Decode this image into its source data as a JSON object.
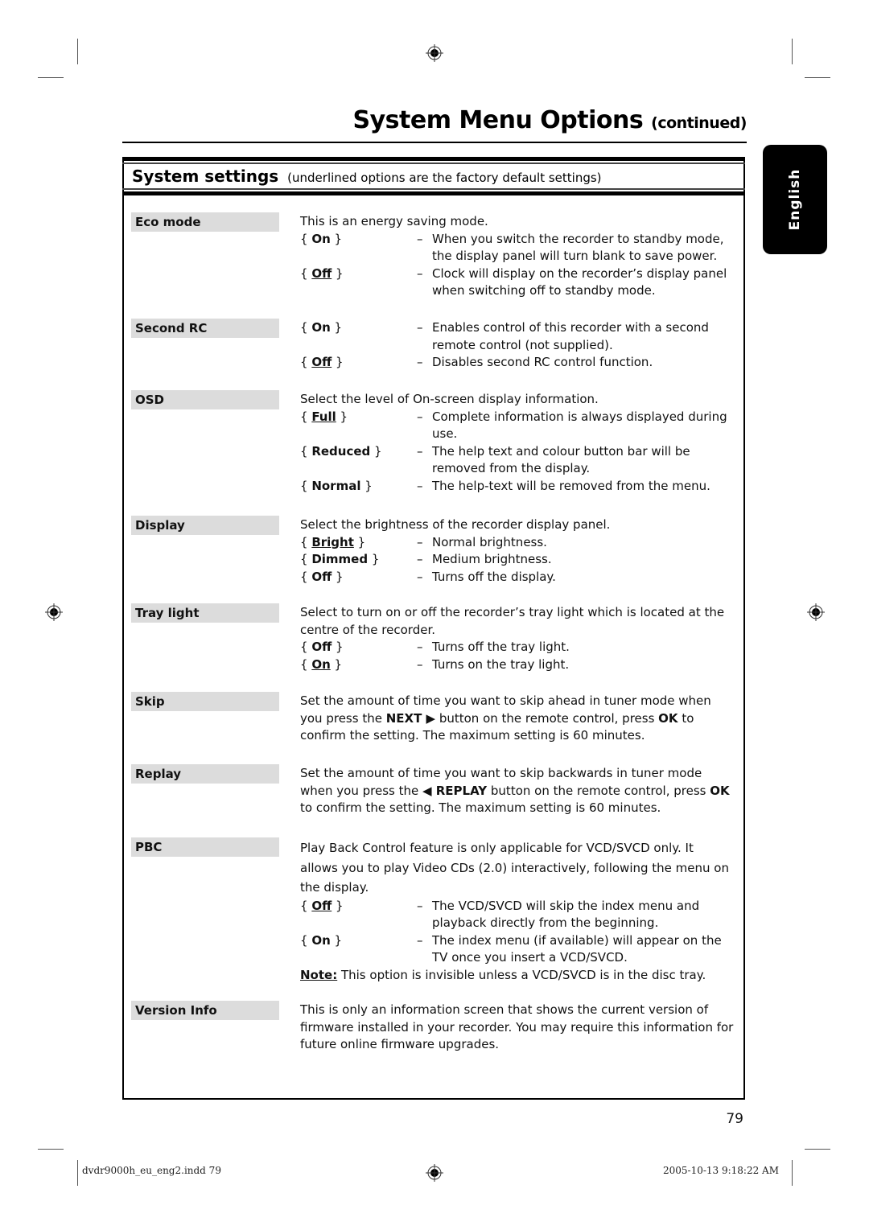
{
  "page": {
    "title": "System Menu Options",
    "title_suffix": "(continued)",
    "language_tab": "English",
    "page_number": "79"
  },
  "section": {
    "title": "System settings",
    "subtitle": "(underlined options are the factory default settings)"
  },
  "settings": [
    {
      "name": "Eco mode",
      "intro": "This is an energy saving mode.",
      "options": [
        {
          "key": "On",
          "default": false,
          "desc": "When you switch the recorder to standby mode, the display panel will turn blank to save power."
        },
        {
          "key": "Off",
          "default": true,
          "desc": "Clock will display on the recorder’s display panel when switching off to standby mode."
        }
      ]
    },
    {
      "name": "Second RC",
      "intro": "",
      "options": [
        {
          "key": "On",
          "default": false,
          "desc": "Enables control of this recorder with a second remote control (not supplied)."
        },
        {
          "key": "Off",
          "default": true,
          "desc": "Disables second RC control function."
        }
      ]
    },
    {
      "name": "OSD",
      "intro": "Select the level of On-screen display information.",
      "options": [
        {
          "key": "Full",
          "default": true,
          "desc": "Complete information is always displayed during use."
        },
        {
          "key": "Reduced",
          "default": false,
          "desc": "The help text and colour button bar will be removed from the display."
        },
        {
          "key": "Normal",
          "default": false,
          "desc": "The help-text will be removed from the menu."
        }
      ]
    },
    {
      "name": "Display",
      "intro": "Select the brightness of the recorder display panel.",
      "options": [
        {
          "key": "Bright",
          "default": true,
          "desc": "Normal brightness."
        },
        {
          "key": "Dimmed",
          "default": false,
          "desc": "Medium brightness."
        },
        {
          "key": "Off",
          "default": false,
          "desc": "Turns off the display."
        }
      ]
    },
    {
      "name": "Tray light",
      "intro": "Select to turn on or off the recorder’s tray light which is located at the centre of the recorder.",
      "options": [
        {
          "key": "Off",
          "default": false,
          "desc": "Turns off the tray light."
        },
        {
          "key": "On",
          "default": true,
          "desc": "Turns on the tray light."
        }
      ]
    },
    {
      "name": "Skip",
      "intro_parts": [
        "Set the amount of time you want to skip ahead in tuner mode when you press the ",
        "NEXT ▶",
        " button on the remote control, press ",
        "OK",
        " to confirm the setting. The maximum setting is 60 minutes."
      ],
      "options": []
    },
    {
      "name": "Replay",
      "intro_parts": [
        "Set the amount of time you want to skip backwards in tuner mode when you press the ",
        "◀ REPLAY",
        " button on the remote control, press ",
        "OK",
        " to confirm the setting. The maximum setting is 60 minutes."
      ],
      "options": []
    },
    {
      "name": "PBC",
      "intro": "Play Back Control feature is only applicable for VCD/SVCD only.  It allows you to play Video CDs (2.0) interactively, following the menu on the display.",
      "options": [
        {
          "key": "Off",
          "default": true,
          "desc": "The VCD/SVCD will skip the index menu and playback directly from the beginning."
        },
        {
          "key": "On",
          "default": false,
          "desc": "The index menu (if available) will appear on the TV once you insert a VCD/SVCD."
        }
      ],
      "note_label": "Note:",
      "note_text": " This option is invisible unless a VCD/SVCD is in the disc tray."
    },
    {
      "name": "Version Info",
      "intro": "This is only an information screen that shows the current version of firmware installed in your recorder. You may require this information for future online firmware upgrades.",
      "options": []
    }
  ],
  "footer": {
    "file": "dvdr9000h_eu_eng2.indd   79",
    "timestamp": "2005-10-13   9:18:22 AM"
  }
}
